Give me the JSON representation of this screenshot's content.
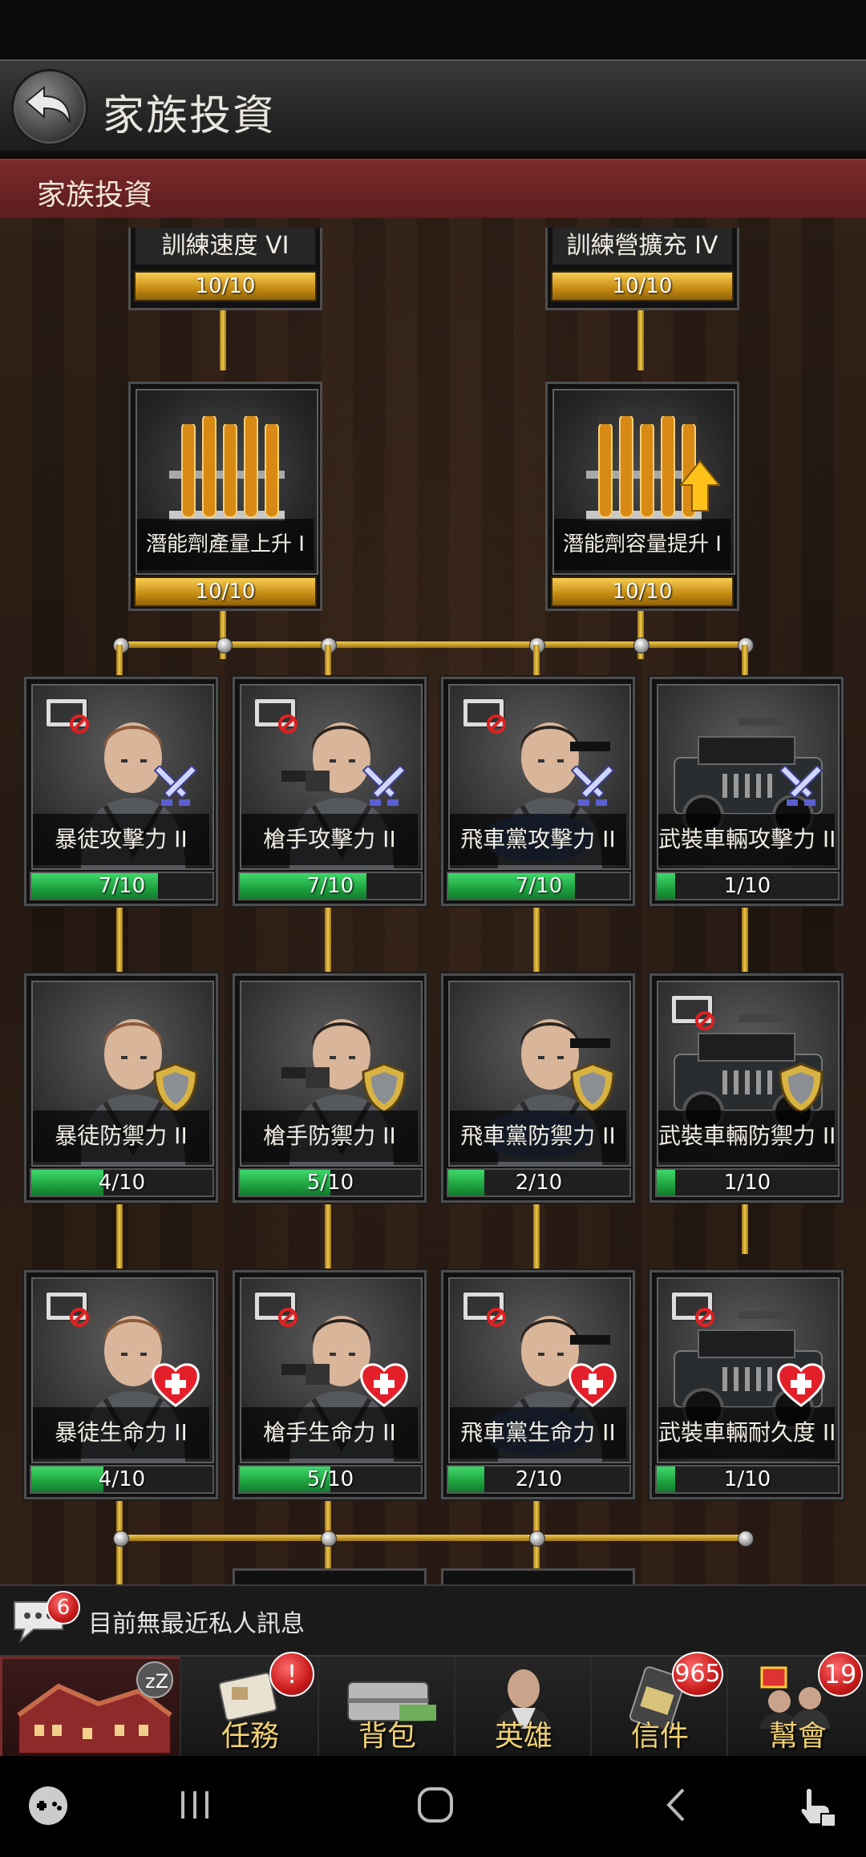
{
  "header": {
    "title": "家族投資"
  },
  "section": {
    "title": "家族投資"
  },
  "top_cards": [
    {
      "name": "訓練速度 VI",
      "progress": "10/10"
    },
    {
      "name": "訓練營擴充 IV",
      "progress": "10/10"
    }
  ],
  "potion_cards": [
    {
      "name": "潛能劑產量上升 I",
      "progress": "10/10"
    },
    {
      "name": "潛能劑容量提升 I",
      "progress": "10/10"
    }
  ],
  "grid": [
    [
      {
        "name": "暴徒攻擊力 II",
        "progress": "7/10",
        "fill": 0.7,
        "unit": "thug",
        "badge": "swords"
      },
      {
        "name": "槍手攻擊力 II",
        "progress": "7/10",
        "fill": 0.7,
        "unit": "gunner",
        "badge": "swords"
      },
      {
        "name": "飛車黨攻擊力 II",
        "progress": "7/10",
        "fill": 0.7,
        "unit": "biker",
        "badge": "swords"
      },
      {
        "name": "武裝車輛攻擊力 II",
        "progress": "1/10",
        "fill": 0.1,
        "unit": "vehicle",
        "badge": "swords"
      }
    ],
    [
      {
        "name": "暴徒防禦力 II",
        "progress": "4/10",
        "fill": 0.4,
        "unit": "thug",
        "badge": "shield"
      },
      {
        "name": "槍手防禦力 II",
        "progress": "5/10",
        "fill": 0.5,
        "unit": "gunner",
        "badge": "shield"
      },
      {
        "name": "飛車黨防禦力 II",
        "progress": "2/10",
        "fill": 0.2,
        "unit": "biker",
        "badge": "shield"
      },
      {
        "name": "武裝車輛防禦力 II",
        "progress": "1/10",
        "fill": 0.1,
        "unit": "vehicle",
        "badge": "shield"
      }
    ],
    [
      {
        "name": "暴徒生命力 II",
        "progress": "4/10",
        "fill": 0.4,
        "unit": "thug",
        "badge": "heart"
      },
      {
        "name": "槍手生命力 II",
        "progress": "5/10",
        "fill": 0.5,
        "unit": "gunner",
        "badge": "heart"
      },
      {
        "name": "飛車黨生命力 II",
        "progress": "2/10",
        "fill": 0.2,
        "unit": "biker",
        "badge": "heart"
      },
      {
        "name": "武裝車輛耐久度 II",
        "progress": "1/10",
        "fill": 0.1,
        "unit": "vehicle",
        "badge": "heart"
      }
    ]
  ],
  "message_bar": {
    "text": "目前無最近私人訊息",
    "unread": "6"
  },
  "nav": [
    {
      "label": "",
      "icon": "mansion-icon"
    },
    {
      "label": "任務",
      "icon": "quest-icon",
      "badge": "!"
    },
    {
      "label": "背包",
      "icon": "briefcase-icon"
    },
    {
      "label": "英雄",
      "icon": "hero-icon"
    },
    {
      "label": "信件",
      "icon": "mail-icon",
      "badge": "965"
    },
    {
      "label": "幫會",
      "icon": "gang-icon",
      "badge": "19"
    }
  ],
  "colors": {
    "gold": "#e0b73a",
    "progress_green": "#2fc356",
    "section_red": "#6b2324"
  }
}
